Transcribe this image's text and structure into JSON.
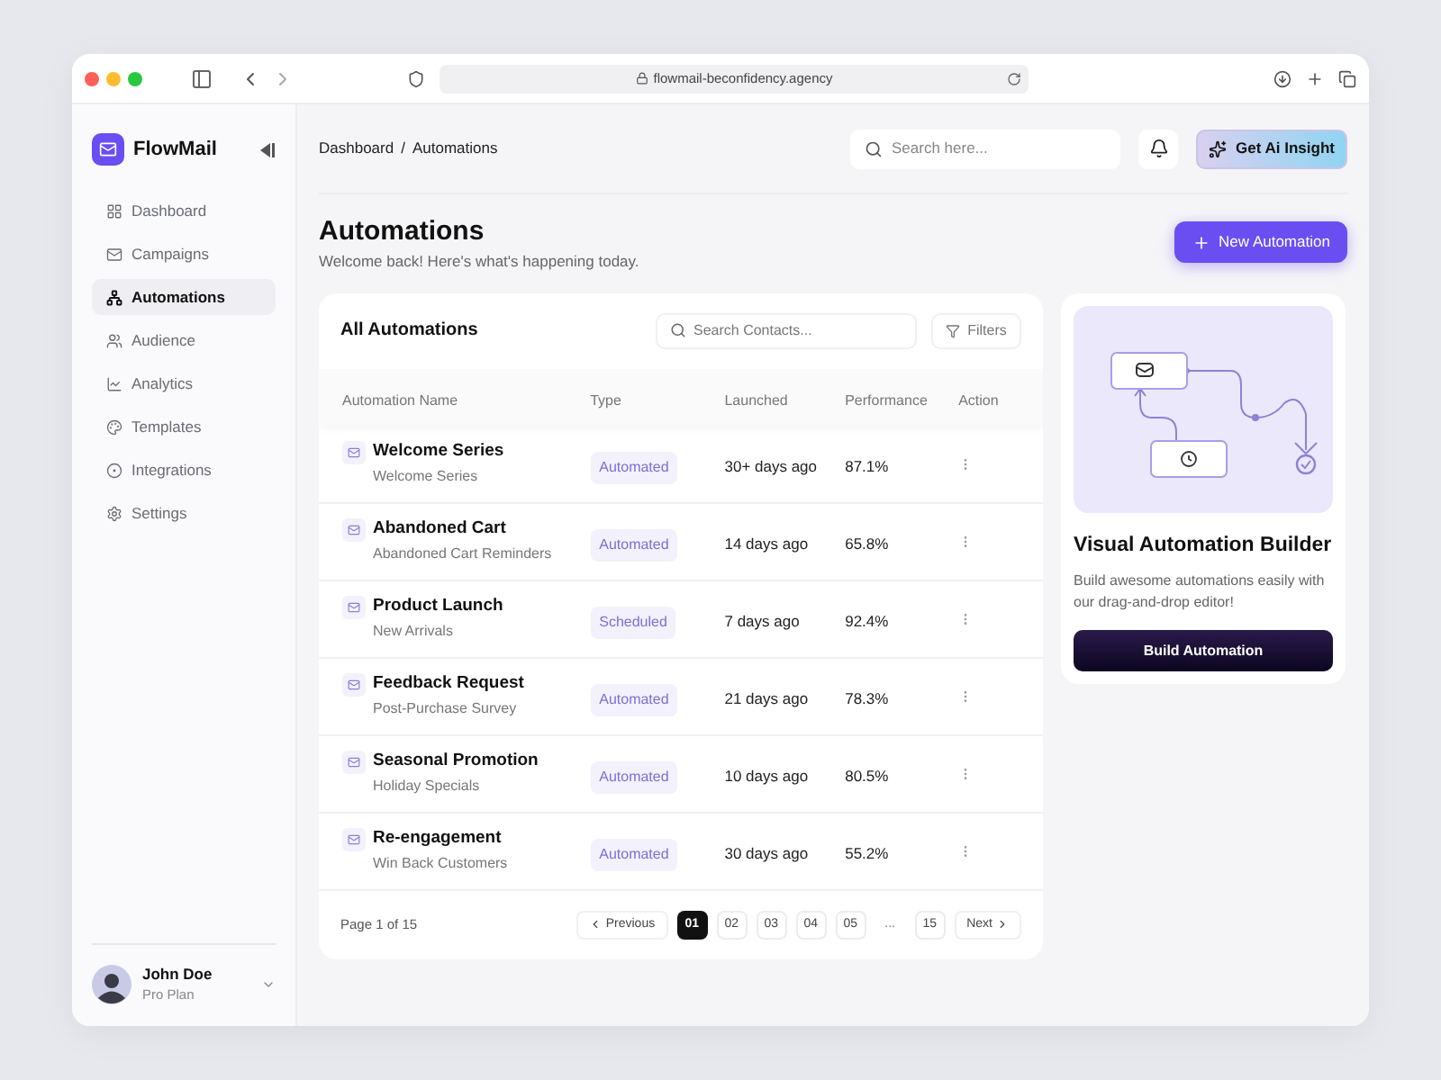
{
  "browser": {
    "url": "flowmail-beconfidency.agency"
  },
  "sidebar": {
    "brand": "FlowMail",
    "items": [
      {
        "label": "Dashboard",
        "selected": false
      },
      {
        "label": "Campaigns",
        "selected": false
      },
      {
        "label": "Automations",
        "selected": true
      },
      {
        "label": "Audience",
        "selected": false
      },
      {
        "label": "Analytics",
        "selected": false
      },
      {
        "label": "Templates",
        "selected": false
      },
      {
        "label": "Integrations",
        "selected": false
      },
      {
        "label": "Settings",
        "selected": false
      }
    ],
    "user": {
      "name": "John Doe",
      "plan": "Pro Plan"
    }
  },
  "header": {
    "breadcrumb": [
      "Dashboard",
      "/",
      "Automations"
    ],
    "search": {
      "placeholder": "Search here..."
    },
    "insight_button": "Get Ai Insight"
  },
  "page": {
    "title": "Automations",
    "subtitle": "Welcome back! Here's what's happening today.",
    "new_button": "New Automation"
  },
  "table": {
    "title": "All Automations",
    "search": {
      "placeholder": "Search Contacts..."
    },
    "filters": "Filters",
    "columns": [
      "Automation Name",
      "Type",
      "Launched",
      "Performance",
      "Action"
    ],
    "rows": [
      {
        "name": "Welcome Series",
        "subtitle": "Welcome Series",
        "type": "Automated",
        "launched": "30+ days ago",
        "performance": "87.1%"
      },
      {
        "name": "Abandoned Cart",
        "subtitle": "Abandoned Cart Reminders",
        "type": "Automated",
        "launched": "14 days ago",
        "performance": "65.8%"
      },
      {
        "name": "Product Launch",
        "subtitle": "New Arrivals",
        "type": "Scheduled",
        "launched": "7 days ago",
        "performance": "92.4%"
      },
      {
        "name": "Feedback Request",
        "subtitle": "Post-Purchase Survey",
        "type": "Automated",
        "launched": "21 days ago",
        "performance": "78.3%"
      },
      {
        "name": "Seasonal Promotion",
        "subtitle": "Holiday Specials",
        "type": "Automated",
        "launched": "10 days ago",
        "performance": "80.5%"
      },
      {
        "name": "Re-engagement",
        "subtitle": "Win Back Customers",
        "type": "Automated",
        "launched": "30 days ago",
        "performance": "55.2%"
      }
    ],
    "pagination": {
      "label": "Page 1 of 15",
      "previous": "Previous",
      "next": "Next",
      "pages": [
        {
          "kind": "page",
          "label": "01",
          "selected": true
        },
        {
          "kind": "page",
          "label": "02",
          "selected": false
        },
        {
          "kind": "page",
          "label": "03",
          "selected": false
        },
        {
          "kind": "page",
          "label": "04",
          "selected": false
        },
        {
          "kind": "page",
          "label": "05",
          "selected": false
        },
        {
          "kind": "ellipsis",
          "label": "..."
        },
        {
          "kind": "page",
          "label": "15",
          "selected": false
        }
      ]
    }
  },
  "promo": {
    "title": "Visual Automation Builder",
    "text": "Build awesome automations easily with our drag-and-drop editor!",
    "button": "Build Automation"
  }
}
